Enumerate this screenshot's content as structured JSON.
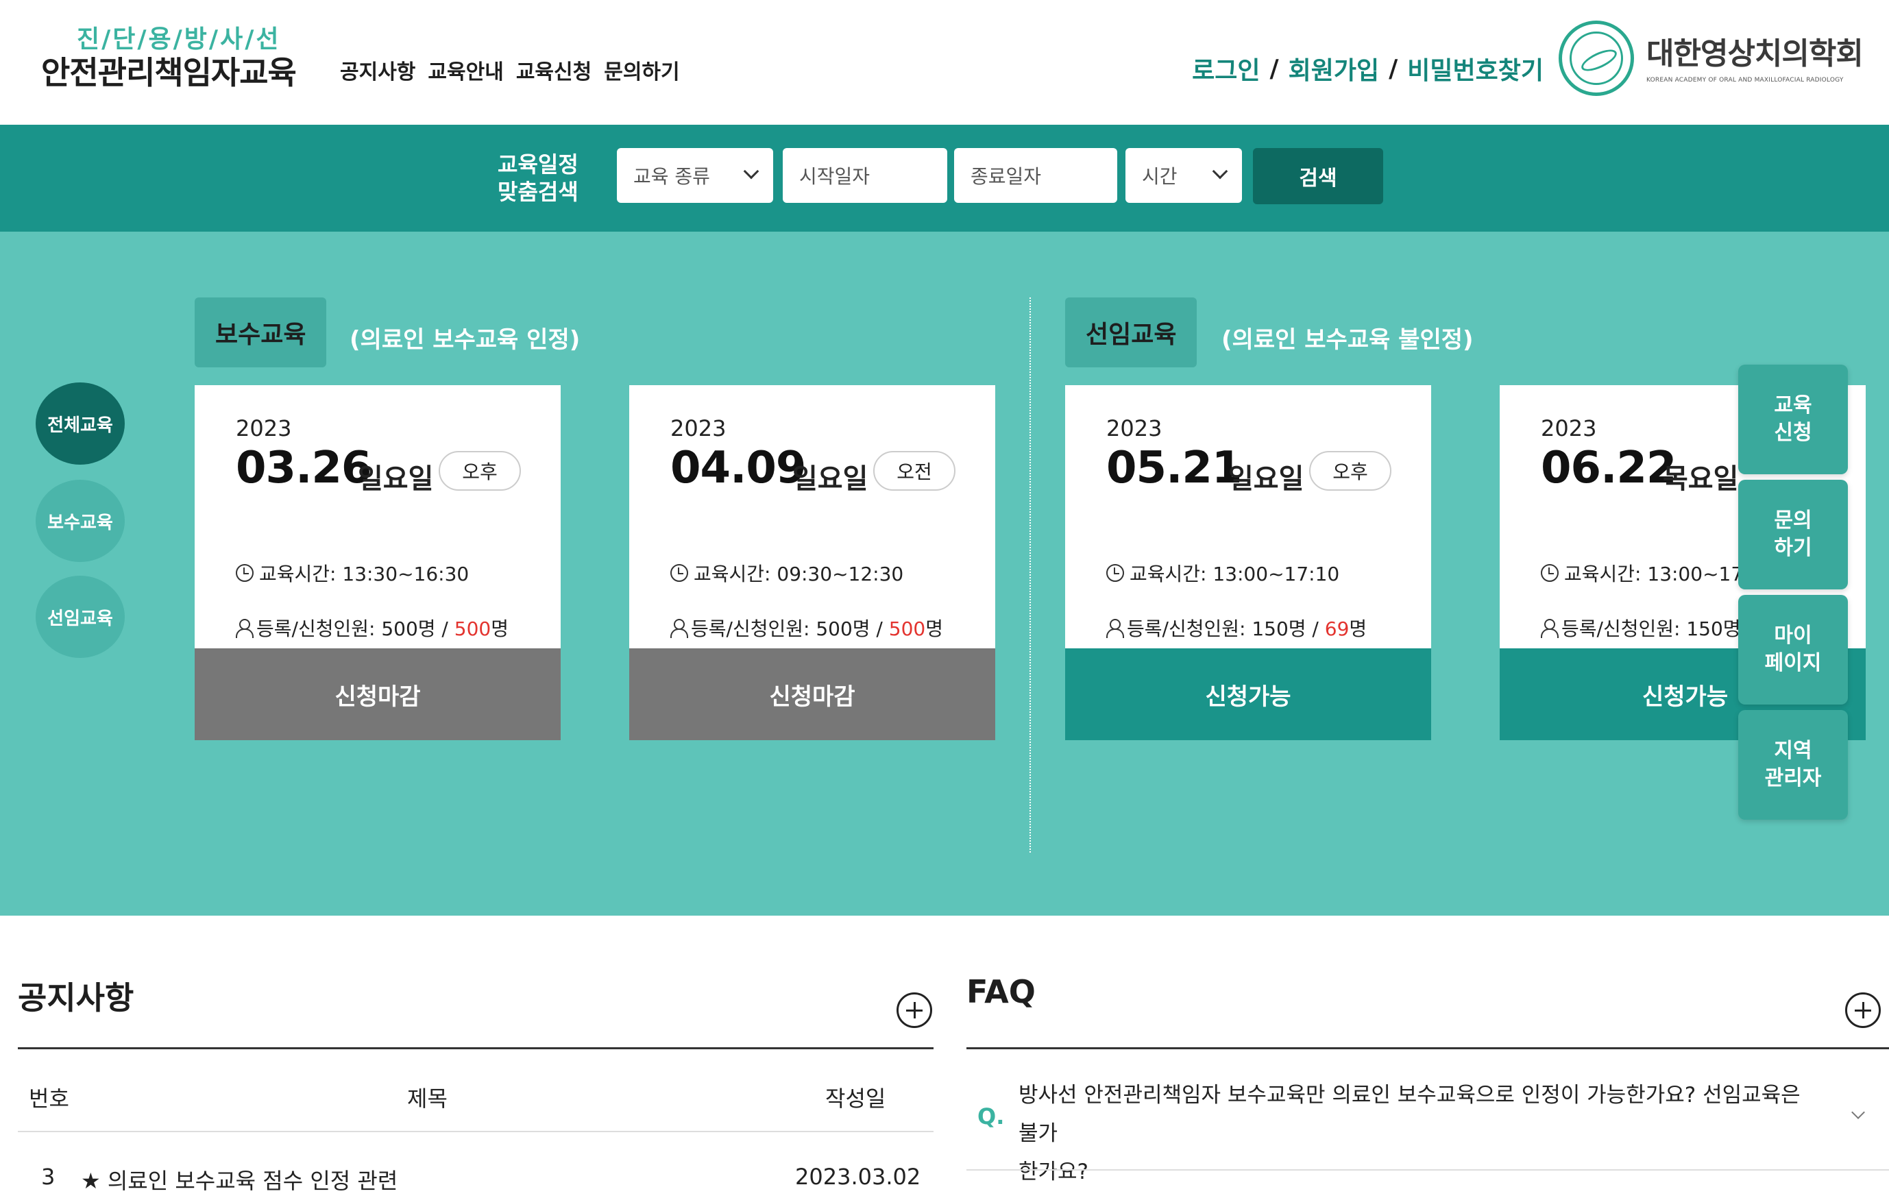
{
  "header": {
    "brand_sub": "진/단/용/방/사/선",
    "brand_main": "안전관리책임자교육",
    "nav": [
      "공지사항",
      "교육안내",
      "교육신청",
      "문의하기"
    ],
    "auth": {
      "login": "로그인",
      "signup": "회원가입",
      "find_password": "비밀번호찾기",
      "separator": "/"
    },
    "logo": {
      "name_ko": "대한영상치의학회",
      "name_en": "KOREAN ACADEMY OF ORAL AND MAXILLOFACIAL RADIOLOGY"
    }
  },
  "search": {
    "label_line1": "교육일정",
    "label_line2": "맞춤검색",
    "type_placeholder": "교육 종류",
    "start_placeholder": "시작일자",
    "end_placeholder": "종료일자",
    "time_placeholder": "시간",
    "button": "검색"
  },
  "side_filters": [
    "전체교육",
    "보수교육",
    "선임교육"
  ],
  "sections": {
    "refresher": {
      "tab": "보수교육",
      "note": "(의료인 보수교육 인정)"
    },
    "appointment": {
      "tab": "선임교육",
      "note": "(의료인 보수교육 불인정)"
    }
  },
  "cards": [
    {
      "year": "2023",
      "date": "03.26",
      "dow": "일요일",
      "ampm": "오후",
      "time": "교육시간: 13:30~16:30",
      "reg_label": "등록/신청인원: 500명 / ",
      "reg_count": "500",
      "reg_unit": "명",
      "status": "신청마감"
    },
    {
      "year": "2023",
      "date": "04.09",
      "dow": "일요일",
      "ampm": "오전",
      "time": "교육시간: 09:30~12:30",
      "reg_label": "등록/신청인원: 500명 / ",
      "reg_count": "500",
      "reg_unit": "명",
      "status": "신청마감"
    },
    {
      "year": "2023",
      "date": "05.21",
      "dow": "일요일",
      "ampm": "오후",
      "time": "교육시간: 13:00~17:10",
      "reg_label": "등록/신청인원: 150명 / ",
      "reg_count": "69",
      "reg_unit": "명",
      "status": "신청가능"
    },
    {
      "year": "2023",
      "date": "06.22",
      "dow": "목요일",
      "ampm": "",
      "time": "교육시간: 13:00~17:",
      "reg_label": "등록/신청인원: 150명",
      "reg_count": "",
      "reg_unit": "",
      "status": "신청가능"
    }
  ],
  "quick_menu": [
    {
      "line1": "교육",
      "line2": "신청"
    },
    {
      "line1": "문의",
      "line2": "하기"
    },
    {
      "line1": "마이",
      "line2": "페이지"
    },
    {
      "line1": "지역",
      "line2": "관리자"
    }
  ],
  "notice": {
    "title": "공지사항",
    "columns": [
      "번호",
      "제목",
      "작성일"
    ],
    "rows": [
      {
        "no": "3",
        "title": "★ 의료인 보수교육 점수 인정 관련",
        "date": "2023.03.02"
      }
    ]
  },
  "faq": {
    "title": "FAQ",
    "q_mark": "Q.",
    "items": [
      {
        "line1": "방사선 안전관리책임자 보수교육만 의료인 보수교육으로 인정이 가능한가요? 선임교육은 불가",
        "line2": "한가요?"
      }
    ]
  },
  "colors": {
    "teal_dark": "#1a948a",
    "teal_light": "#5ec4b9",
    "closed_gray": "#777777",
    "accent_red": "#e3342f"
  }
}
